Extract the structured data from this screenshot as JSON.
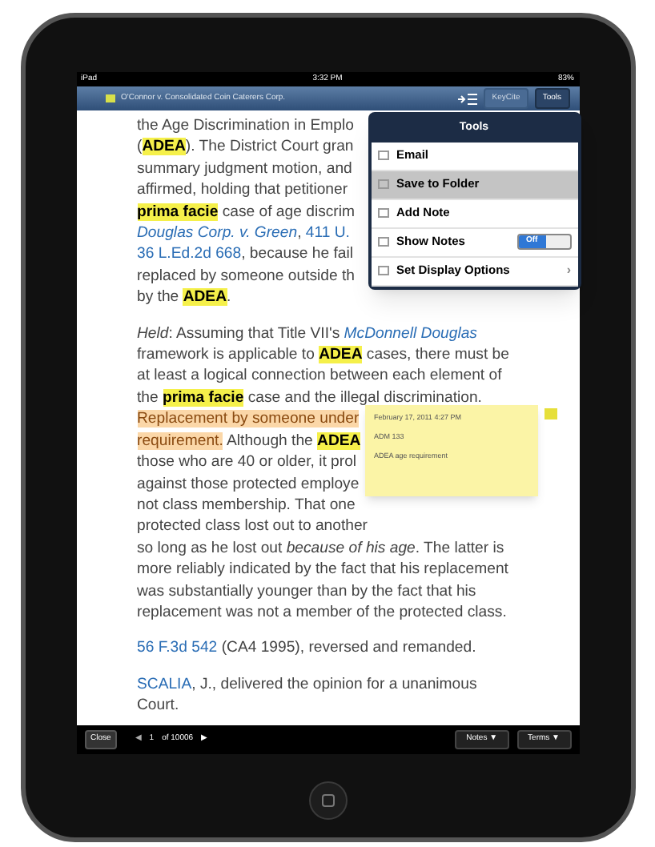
{
  "status_bar": {
    "device": "iPad",
    "time": "3:32 PM",
    "battery": "83%"
  },
  "nav_bar": {
    "document_title": "O'Connor v. Consolidated Coin Caterers Corp.",
    "buttons": [
      {
        "label": "KeyCite",
        "selected": false
      },
      {
        "label": "Tools",
        "selected": true
      }
    ]
  },
  "paragraphs": [
    [
      [
        {
          "kind": "plain",
          "text": "the Age Discrimination in Emplo"
        }
      ],
      [
        {
          "kind": "plain",
          "text": "("
        },
        {
          "kind": "highlight",
          "text": "ADEA"
        },
        {
          "kind": "plain",
          "text": "). The District Court gran"
        }
      ],
      [
        {
          "kind": "plain",
          "text": "summary judgment motion, and"
        }
      ],
      [
        {
          "kind": "plain",
          "text": "affirmed, holding that petitioner"
        }
      ],
      [
        {
          "kind": "highlight",
          "text": "prima facie"
        },
        {
          "kind": "plain",
          "text": " case of age discrim"
        }
      ],
      [
        {
          "kind": "link_italic",
          "text": "Douglas Corp. v. Green"
        },
        {
          "kind": "plain",
          "text": ", "
        },
        {
          "kind": "link",
          "text": "411 U."
        }
      ],
      [
        {
          "kind": "link",
          "text": "36 L.Ed.2d 668"
        },
        {
          "kind": "plain",
          "text": ", because he fail"
        }
      ],
      [
        {
          "kind": "plain",
          "text": "replaced by someone outside th"
        }
      ],
      [
        {
          "kind": "plain",
          "text": "by the "
        },
        {
          "kind": "highlight",
          "text": "ADEA"
        },
        {
          "kind": "plain",
          "text": "."
        }
      ]
    ],
    [
      [
        {
          "kind": "italic",
          "text": "Held"
        },
        {
          "kind": "plain",
          "text": ": Assuming that Title VII's "
        },
        {
          "kind": "link_italic",
          "text": "McDonnell Douglas"
        }
      ],
      [
        {
          "kind": "plain",
          "text": "framework is applicable to "
        },
        {
          "kind": "highlight",
          "text": "ADEA"
        },
        {
          "kind": "plain",
          "text": " cases, there must be"
        }
      ],
      [
        {
          "kind": "plain",
          "text": "at least a logical connection between each element of"
        }
      ],
      [
        {
          "kind": "plain",
          "text": "the "
        },
        {
          "kind": "highlight",
          "text": "prima facie"
        },
        {
          "kind": "plain",
          "text": " case and the illegal discrimination."
        }
      ],
      [
        {
          "kind": "note_highlight",
          "text": "Replacement by someone under"
        }
      ],
      [
        {
          "kind": "note_highlight",
          "text": "requirement."
        },
        {
          "kind": "plain",
          "text": " Although the "
        },
        {
          "kind": "highlight",
          "text": "ADEA"
        }
      ],
      [
        {
          "kind": "plain",
          "text": "those who are 40 or older, it prol"
        }
      ],
      [
        {
          "kind": "plain",
          "text": "against those protected employe"
        }
      ],
      [
        {
          "kind": "plain",
          "text": "not class membership. That one"
        }
      ],
      [
        {
          "kind": "plain",
          "text": "protected class lost out to another"
        }
      ],
      [
        {
          "kind": "plain",
          "text": "so long as he lost out "
        },
        {
          "kind": "italic",
          "text": "because of his age"
        },
        {
          "kind": "plain",
          "text": ". The latter is"
        }
      ],
      [
        {
          "kind": "plain",
          "text": "more reliably indicated by the fact that his replacement"
        }
      ],
      [
        {
          "kind": "plain",
          "text": "was substantially younger than by the fact that his"
        }
      ],
      [
        {
          "kind": "plain",
          "text": "replacement was not a member of the protected class."
        }
      ]
    ],
    [
      [
        {
          "kind": "link",
          "text": "56 F.3d 542"
        },
        {
          "kind": "plain",
          "text": " (CA4 1995), reversed and remanded."
        }
      ]
    ],
    [
      [
        {
          "kind": "link",
          "text": "SCALIA"
        },
        {
          "kind": "plain",
          "text": ", J., delivered the opinion for a unanimous"
        }
      ],
      [
        {
          "kind": "plain",
          "text": "Court."
        }
      ]
    ]
  ],
  "tools_menu": {
    "title": "Tools",
    "items": [
      {
        "kind": "action",
        "label": "Email",
        "selected": false
      },
      {
        "kind": "action",
        "label": "Save to Folder",
        "selected": true
      },
      {
        "kind": "action",
        "label": "Add Note",
        "selected": false
      },
      {
        "kind": "toggle",
        "label": "Show Notes",
        "selected": false,
        "on": false,
        "switch_label": "Off"
      },
      {
        "kind": "submenu",
        "label": "Set Display Options",
        "selected": false,
        "chevron": "›"
      }
    ]
  },
  "note": {
    "date": "February 17, 2011 4:27 PM",
    "author": "ADM 133",
    "text": "ADEA age requirement"
  },
  "bottom_bar": {
    "close": "Close",
    "prev": "◀",
    "page": "1",
    "of": "of 10006",
    "next": "▶",
    "notes": "Notes ▼",
    "terms": "Terms ▼"
  }
}
